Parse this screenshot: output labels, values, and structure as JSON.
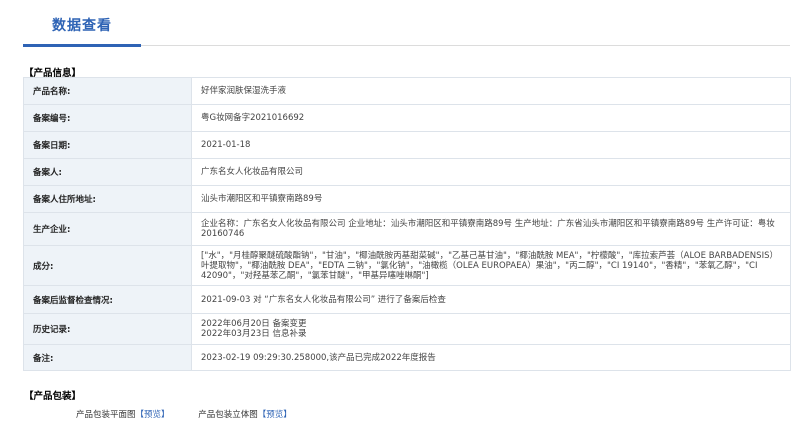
{
  "tabs": {
    "active": "数据查看"
  },
  "product_info": {
    "title": "【产品信息】",
    "rows": [
      {
        "key": "产品名称:",
        "value": "好伴家润肤保湿洗手液"
      },
      {
        "key": "备案编号:",
        "value": "粤G妆网备字2021016692"
      },
      {
        "key": "备案日期:",
        "value": "2021-01-18"
      },
      {
        "key": "备案人:",
        "value": "广东名女人化妆品有限公司"
      },
      {
        "key": "备案人住所地址:",
        "value": "汕头市潮阳区和平镇寮南路89号"
      },
      {
        "key": "生产企业:",
        "value": "企业名称：广东名女人化妆品有限公司 企业地址：汕头市潮阳区和平镇寮南路89号 生产地址：广东省汕头市潮阳区和平镇寮南路89号 生产许可证：粤妆20160746"
      },
      {
        "key": "成分:",
        "value": "[\"水\"，\"月桂醇聚醚硫酸酯钠\"，\"甘油\"，\"椰油酰胺丙基甜菜碱\"，\"乙基己基甘油\"，\"椰油酰胺 MEA\"，\"柠檬酸\"，\"库拉索芦荟（ALOE BARBADENSIS）叶提取物\"，\"椰油酰胺 DEA\"，\"EDTA 二钠\"，\"氯化钠\"，\"油橄榄（OLEA EUROPAEA）果油\"，\"丙二醇\"，\"CI 19140\"，\"香精\"，\"苯氧乙醇\"，\"CI 42090\"，\"对羟基苯乙酮\"，\"氯苯甘醚\"，\"甲基异噻唑啉酮\"]"
      },
      {
        "key": "备案后监督检查情况:",
        "value": "2021-09-03 对 “广东名女人化妆品有限公司” 进行了备案后检查"
      },
      {
        "key": "历史记录:",
        "value": "2022年06月20日 备案变更\n2022年03月23日 信息补录"
      },
      {
        "key": "备注:",
        "value": "2023-02-19 09:29:30.258000,该产品已完成2022年度报告"
      }
    ]
  },
  "packaging": {
    "title": "【产品包装】",
    "flat_label": "产品包装平面图",
    "flat_link": "【预览】",
    "stereo_label": "产品包装立体图",
    "stereo_link": "【预览】"
  }
}
